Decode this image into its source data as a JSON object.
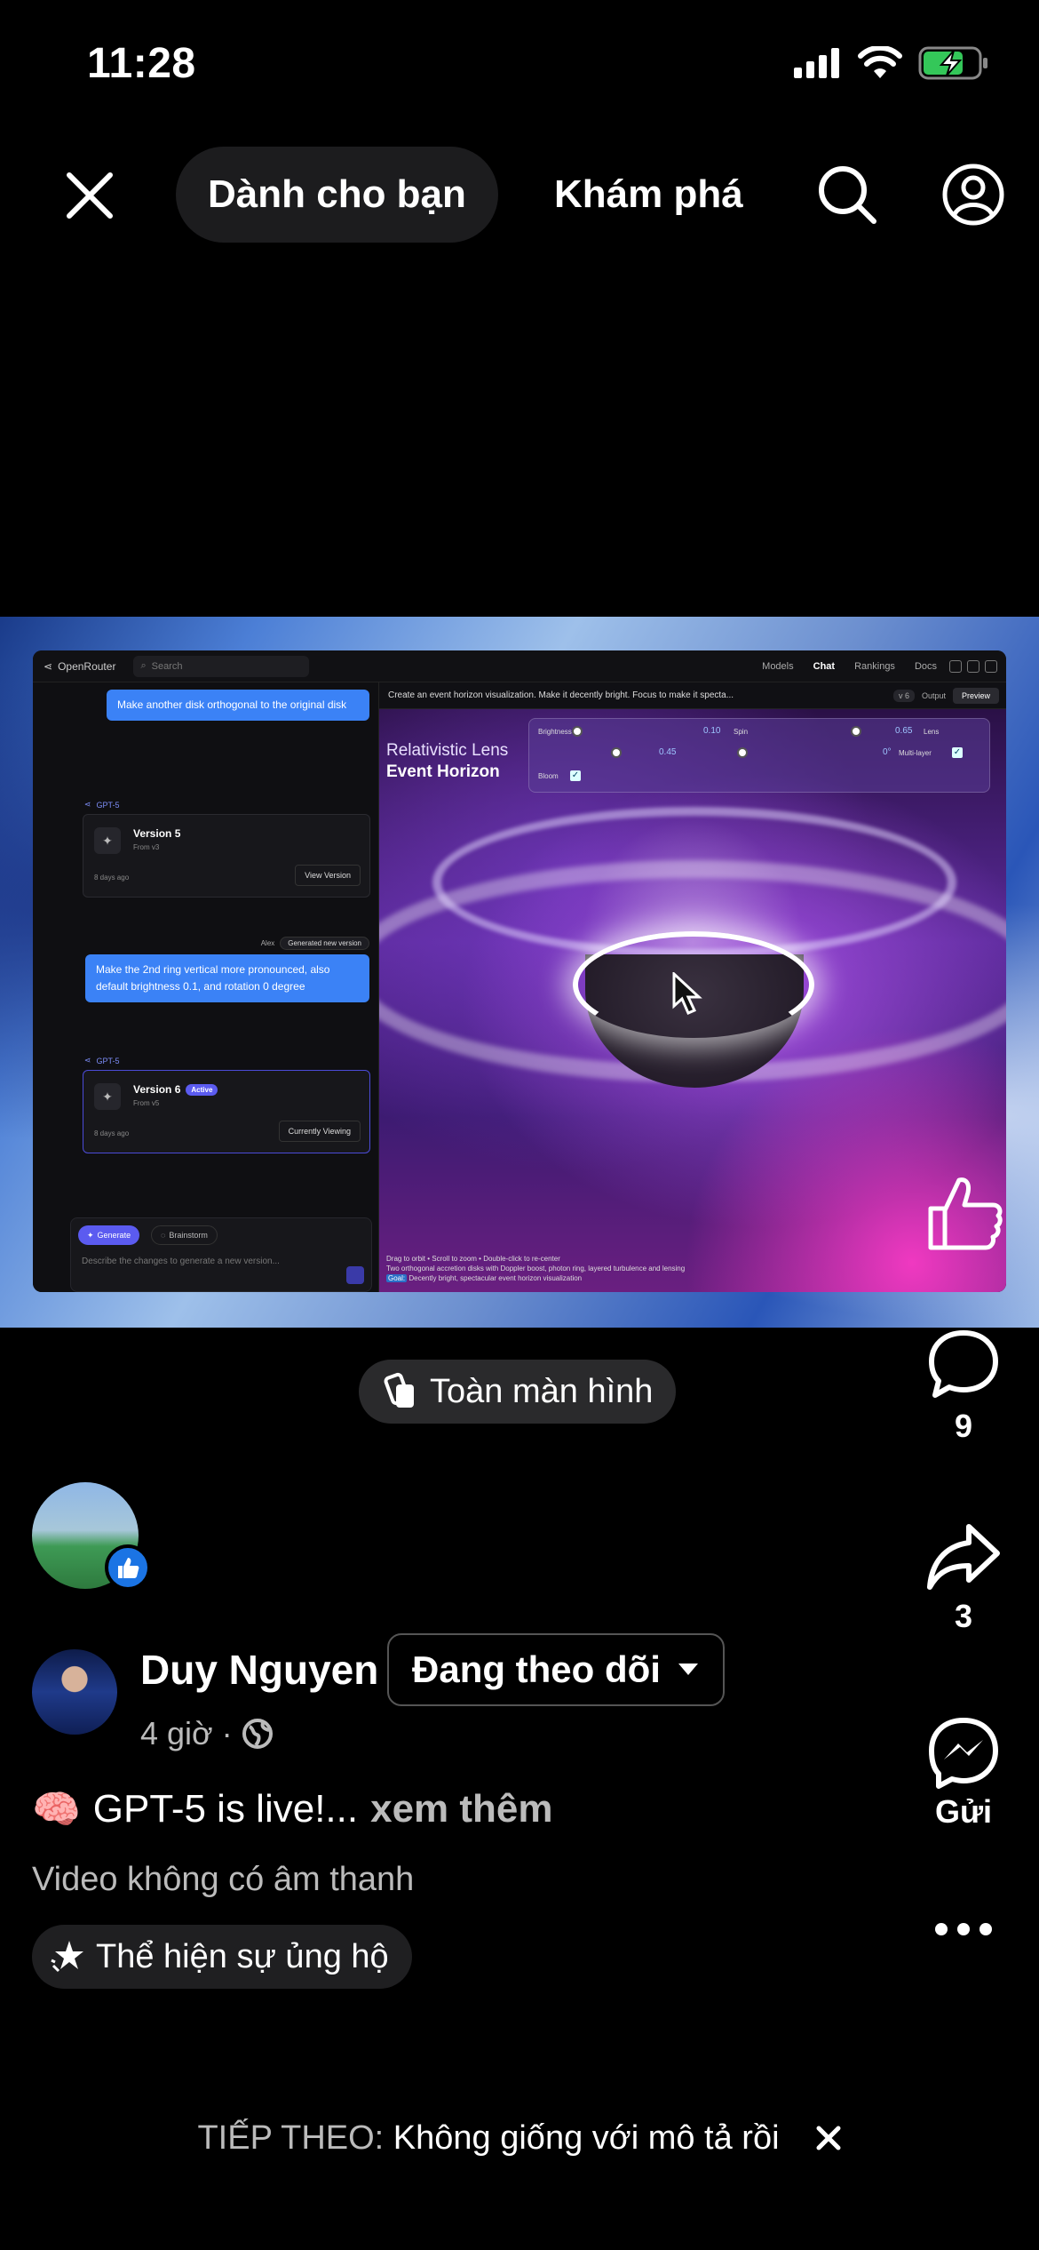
{
  "status_bar": {
    "time": "11:28"
  },
  "top_nav": {
    "tab_for_you": "Dành cho bạn",
    "tab_explore": "Khám phá"
  },
  "video": {
    "app": {
      "brand": "OpenRouter",
      "search_placeholder": "Search",
      "nav": [
        "Models",
        "Chat",
        "Rankings",
        "Docs"
      ],
      "messages": {
        "user_1": "Make another disk orthogonal to the original disk",
        "model_tag": "GPT-5",
        "user_2": "Make the 2nd ring vertical more pronounced, also default brightness 0.1, and rotation 0 degree",
        "author": "Alex",
        "generated_chip": "Generated new version"
      },
      "cards": [
        {
          "title": "Version 5",
          "sub": "From v3",
          "time": "8 days ago",
          "button": "View Version",
          "badge": ""
        },
        {
          "title": "Version 6",
          "sub": "From v5",
          "time": "8 days ago",
          "button": "Currently Viewing",
          "badge": "Active"
        }
      ],
      "composer": {
        "generate": "Generate",
        "brainstorm": "Brainstorm",
        "placeholder": "Describe the changes to generate a new version..."
      },
      "prompt": "Create an event horizon visualization. Make it decently bright. Focus to make it specta...",
      "prompt_tabs": {
        "version": "v 6",
        "output": "Output",
        "preview": "Preview"
      },
      "scene_title_1": "Relativistic Lens",
      "scene_title_2": "Event Horizon",
      "controls": {
        "brightness_label": "Brightness",
        "brightness_val": "0.10",
        "spin_label": "Spin",
        "spin_val": "0.65",
        "lens_label": "Lens",
        "row2_val": "0.45",
        "rotation_val": "0°",
        "multilayer_label": "Multi-layer",
        "bloom_label": "Bloom"
      },
      "footer": {
        "line1": "Drag to orbit • Scroll to zoom • Double-click to re-center",
        "line2": "Two orthogonal accretion disks with Doppler boost, photon ring, layered turbulence and lensing",
        "goal_tag": "Goal:",
        "goal_text": "Decently bright, spectacular event horizon visualization"
      }
    }
  },
  "actions": {
    "comments": "9",
    "shares": "3",
    "send": "Gửi"
  },
  "fullscreen_label": "Toàn màn hình",
  "post": {
    "author": "Duy Nguyen",
    "follow_label": "Đang theo dõi",
    "time": "4 giờ ·",
    "caption": "GPT-5 is live!...",
    "see_more": "xem thêm",
    "no_audio": "Video không có âm thanh",
    "support": "Thể hiện sự ủng hộ"
  },
  "next_up": {
    "label": "TIẾP THEO:",
    "title": "Không giống với mô tả rồi"
  },
  "colors": {
    "accent": "#1b74e4",
    "background": "#000000"
  }
}
